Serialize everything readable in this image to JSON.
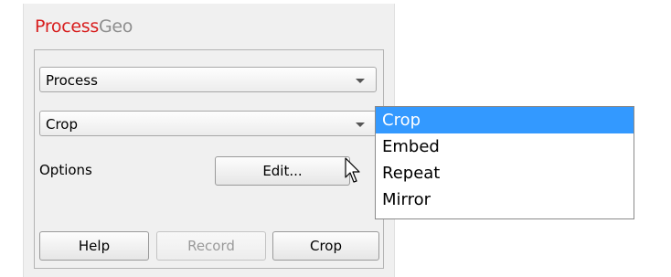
{
  "app": {
    "title_part1": "Process",
    "title_part2": "Geo"
  },
  "controls": {
    "process_combo": {
      "value": "Process"
    },
    "operation_combo": {
      "value": "Crop"
    },
    "options_label": "Options",
    "edit_button": "Edit..."
  },
  "buttons": {
    "help": "Help",
    "record": "Record",
    "crop": "Crop"
  },
  "dropdown": {
    "items": [
      {
        "label": "Crop",
        "selected": true
      },
      {
        "label": "Embed"
      },
      {
        "label": "Repeat"
      },
      {
        "label": "Mirror"
      }
    ]
  },
  "colors": {
    "title_accent": "#d81e1e",
    "title_muted": "#8e8e8e",
    "selection": "#3399ff"
  }
}
